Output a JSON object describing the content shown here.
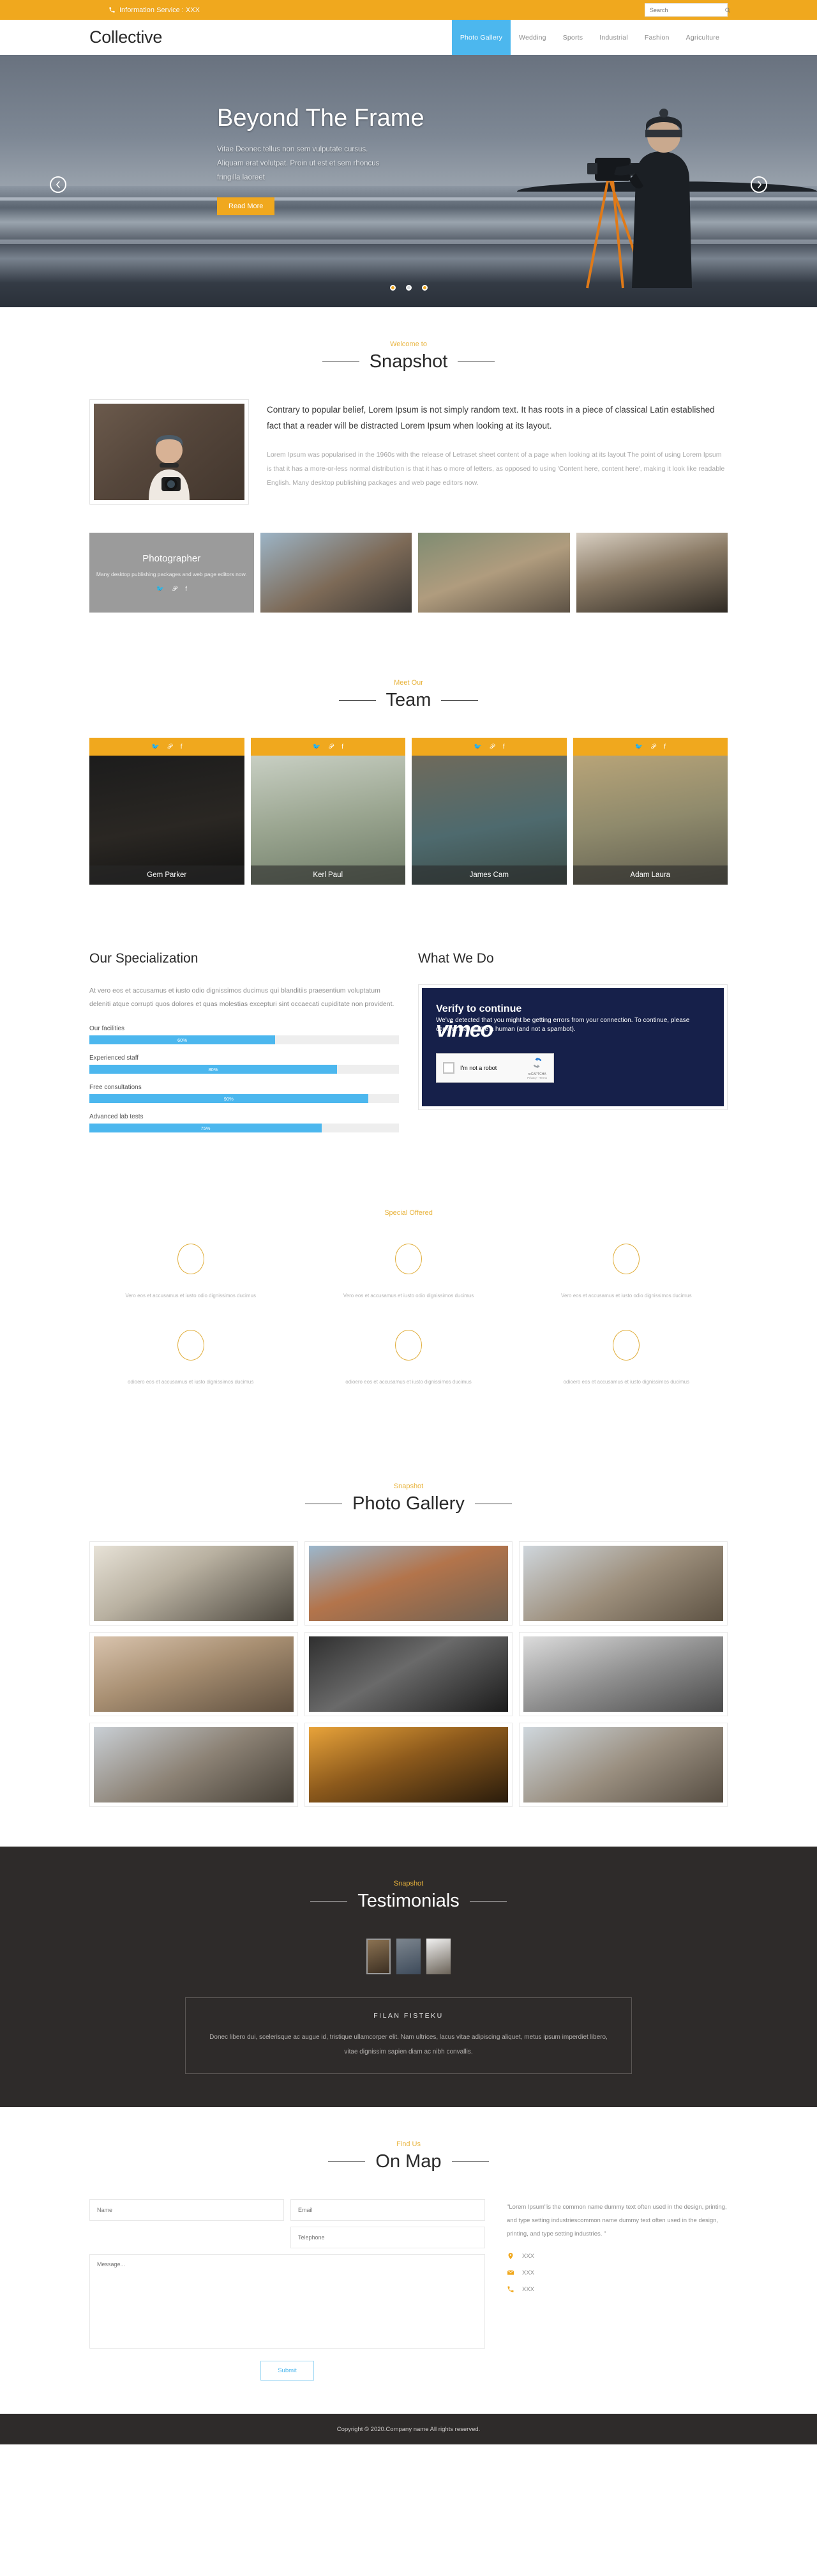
{
  "topbar": {
    "info_text": "Information Service : XXX",
    "phone_icon": "phone-icon",
    "search_placeholder": "Search",
    "search_value": "",
    "search_icon": "search-icon",
    "bg_color": "#f0a81e"
  },
  "header": {
    "logo": "Collective",
    "nav": [
      {
        "label": "Photo Gallery",
        "active": true
      },
      {
        "label": "Wedding",
        "active": false
      },
      {
        "label": "Sports",
        "active": false
      },
      {
        "label": "Industrial",
        "active": false
      },
      {
        "label": "Fashion",
        "active": false
      },
      {
        "label": "Agriculture",
        "active": false
      }
    ],
    "active_color": "#4cb7ee"
  },
  "hero": {
    "title": "Beyond The Frame",
    "subtitle": "Vitae Deonec tellus non sem vulputate cursus. Aliquam erat volutpat. Proin ut est et sem rhoncus fringilla laoreet",
    "button": "Read More",
    "prev_icon": "chevron-left-icon",
    "next_icon": "chevron-right-icon",
    "dots": [
      "active",
      "inactive",
      "active"
    ]
  },
  "snapshot": {
    "pre": "Welcome to",
    "title": "Snapshot",
    "lead": "Contrary to popular belief, Lorem Ipsum is not simply random text. It has roots in a piece of classical Latin established fact that a reader will be distracted Lorem Ipsum when looking at its layout.",
    "body": "Lorem Ipsum was popularised in the 1960s with the release of Letraset sheet content of a page when looking at its layout The point of using Lorem Ipsum is that it has a more-or-less normal distribution is that it has o more of letters, as opposed to using 'Content here, content here', making it look like readable English. Many desktop publishing packages and web page editors now.",
    "card": {
      "title": "Photographer",
      "text": "Many desktop publishing packages and web page editors now.",
      "social": [
        "twitter-icon",
        "pinterest-icon",
        "facebook-icon"
      ]
    }
  },
  "team": {
    "pre": "Meet Our",
    "title": "Team",
    "social": [
      "twitter-icon",
      "pinterest-icon",
      "facebook-icon"
    ],
    "members": [
      {
        "name": "Gem Parker"
      },
      {
        "name": "Kerl Paul"
      },
      {
        "name": "James Cam"
      },
      {
        "name": "Adam Laura"
      }
    ]
  },
  "specialization": {
    "title": "Our Specialization",
    "lead": "At vero eos et accusamus et iusto odio dignissimos ducimus qui blanditiis praesentium voluptatum deleniti atque corrupti quos dolores et quas molestias excepturi sint occaecati cupiditate non provident.",
    "skills": [
      {
        "label": "Our facilities",
        "value": 60,
        "display": "60%"
      },
      {
        "label": "Experienced staff",
        "value": 80,
        "display": "80%"
      },
      {
        "label": "Free consultations",
        "value": 90,
        "display": "90%"
      },
      {
        "label": "Advanced lab tests",
        "value": 75,
        "display": "75%"
      }
    ],
    "bar_color": "#4cb7ee"
  },
  "what_we_do": {
    "title": "What We Do",
    "video": {
      "heading": "Verify to continue",
      "body": "We've detected that you might be getting errors from your connection. To continue, please confirm that you're a human (and not a spambot).",
      "brand": "vimeo",
      "recaptcha_label": "I'm not a robot",
      "recaptcha_name": "reCAPTCHA",
      "recaptcha_terms": "Privacy - Terms"
    }
  },
  "offers": {
    "pre": "Special Offered",
    "row1": [
      "Vero eos et accusamus et iusto odio dignissimos ducimus",
      "Vero eos et accusamus et iusto odio dignissimos ducimus",
      "Vero eos et accusamus et iusto odio dignissimos ducimus"
    ],
    "row2": [
      "odioero eos et accusamus et iusto dignissimos ducimus",
      "odioero eos et accusamus et iusto dignissimos ducimus",
      "odioero eos et accusamus et iusto dignissimos ducimus"
    ],
    "circle_color": "#e0ad3a"
  },
  "gallery": {
    "pre": "Snapshot",
    "title": "Photo Gallery",
    "items": [
      "vintage-camera-photo",
      "photographer-on-hill-photo",
      "photographer-ruins-photo",
      "woman-telephoto-photo",
      "hands-holding-camera-photo",
      "man-with-camera-photo",
      "photographer-city-photo",
      "sunset-silhouette-photo",
      "woman-camera-outdoor-photo"
    ]
  },
  "testimonials": {
    "pre": "Snapshot",
    "title": "Testimonials",
    "avatars": [
      "avatar-1",
      "avatar-2",
      "avatar-3"
    ],
    "name": "FILAN FISTEKU",
    "quote": "Donec libero dui, scelerisque ac augue id, tristique ullamcorper elit. Nam ultrices, lacus vitae adipiscing aliquet, metus ipsum imperdiet libero, vitae dignissim sapien diam ac nibh convallis."
  },
  "map": {
    "pre": "Find Us",
    "title": "On Map",
    "form": {
      "name_placeholder": "Name",
      "email_placeholder": "Email",
      "telephone_placeholder": "Telephone",
      "message_placeholder": "Message...",
      "submit_label": "Submit",
      "name_value": "",
      "email_value": "",
      "telephone_value": "",
      "message_value": ""
    },
    "info_text": "\"Lorem Ipsum\"is the common name dummy text often used in the design, printing, and type setting industriescommon name dummy text often used in the design, printing, and type setting industries. \"",
    "contacts": [
      {
        "icon": "location-pin-icon",
        "value": "XXX"
      },
      {
        "icon": "envelope-icon",
        "value": "XXX"
      },
      {
        "icon": "phone-icon",
        "value": "XXX"
      }
    ]
  },
  "footer": {
    "copyright": "Copyright © 2020.Company name All rights reserved."
  }
}
